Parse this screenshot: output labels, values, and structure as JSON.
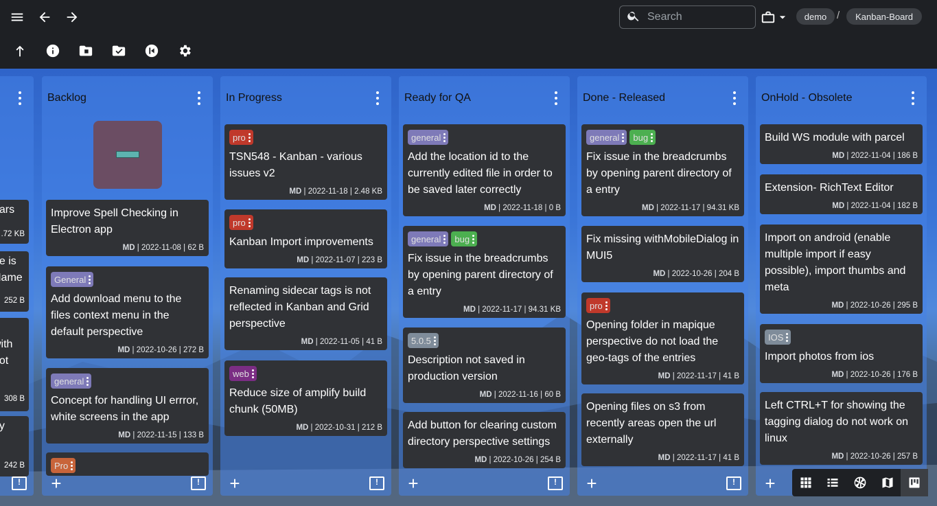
{
  "search": {
    "placeholder": "Search"
  },
  "breadcrumb": {
    "location": "demo",
    "folder": "Kanban-Board"
  },
  "columns": [
    {
      "title": "Backlog"
    },
    {
      "title": "In Progress"
    },
    {
      "title": "Ready for QA"
    },
    {
      "title": "Done - Released"
    },
    {
      "title": "OnHold - Obsolete"
    }
  ],
  "partial_col": {
    "texts": [
      "ears",
      ".72 KB",
      "ge is",
      "Name",
      "252 B",
      "with",
      "not",
      "308 B",
      "by",
      "n",
      "242 B"
    ]
  },
  "backlog": [
    {
      "title": "Improve Spell Checking in Electron app",
      "date": "2022-11-08",
      "size": "62 B",
      "author": "MD"
    },
    {
      "tag": "General",
      "title": "Add download menu to the files context menu in the default perspective",
      "date": "2022-10-26",
      "size": "272 B",
      "author": "MD"
    },
    {
      "tag": "general",
      "title": "Concept for handling UI errror, white screens in the app",
      "date": "2022-11-15",
      "size": "133 B",
      "author": "MD"
    },
    {
      "tag": "Pro"
    }
  ],
  "inprogress": [
    {
      "tag": "pro",
      "title": "TSN548 - Kanban - various issues v2",
      "date": "2022-11-18",
      "size": "2.48 KB",
      "author": "MD"
    },
    {
      "tag": "pro",
      "title": "Kanban Import improvements",
      "date": "2022-11-07",
      "size": "223 B",
      "author": "MD"
    },
    {
      "title": "Renaming sidecar tags is not reflected in Kanban and Grid perspective",
      "date": "2022-11-05",
      "size": "41 B",
      "author": "MD"
    },
    {
      "tag": "web",
      "title": "Reduce size of amplify build chunk (50MB)",
      "date": "2022-10-31",
      "size": "212 B",
      "author": "MD"
    }
  ],
  "readyqa": [
    {
      "tag": "general",
      "title": "Add the location id to the currently edited file in order to be saved later correctly",
      "date": "2022-11-18",
      "size": "0 B",
      "author": "MD"
    },
    {
      "tag": "general",
      "tag2": "bug",
      "title": "Fix issue in the breadcrumbs by opening parent directory of a entry",
      "date": "2022-11-17",
      "size": "94.31 KB",
      "author": "MD"
    },
    {
      "tag": "5.0.5",
      "title": "Description not saved in production version",
      "date": "2022-11-16",
      "size": "60 B",
      "author": "MD"
    },
    {
      "title": "Add button for clearing custom directory perspective settings",
      "date": "2022-10-26",
      "size": "254 B",
      "author": "MD"
    }
  ],
  "done": [
    {
      "tag": "general",
      "tag2": "bug",
      "title": "Fix issue in the breadcrumbs by opening parent directory of a entry",
      "date": "2022-11-17",
      "size": "94.31 KB",
      "author": "MD"
    },
    {
      "title": "Fix missing withMobileDialog in MUI5",
      "date": "2022-10-26",
      "size": "204 B",
      "author": "MD"
    },
    {
      "tag": "pro",
      "title": "Opening folder in mapique perspective do not load the geo-tags of the entries",
      "date": "2022-11-17",
      "size": "41 B",
      "author": "MD"
    },
    {
      "title": "Opening files on s3 from recently areas open the url externally",
      "date": "2022-11-17",
      "size": "41 B",
      "author": "MD"
    }
  ],
  "onhold": [
    {
      "title": "Build WS module with parcel",
      "date": "2022-11-04",
      "size": "186 B",
      "author": "MD"
    },
    {
      "title": "Extension- RichText Editor",
      "date": "2022-11-04",
      "size": "182 B",
      "author": "MD"
    },
    {
      "title": "Import on android (enable multiple import if easy possible), import thumbs and meta",
      "date": "2022-10-26",
      "size": "295 B",
      "author": "MD"
    },
    {
      "tag": "IOS",
      "title": "Import photos from ios",
      "date": "2022-10-26",
      "size": "176 B",
      "author": "MD"
    },
    {
      "title": "Left CTRL+T for showing the tagging dialog do not work on linux",
      "date": "2022-10-26",
      "size": "257 B",
      "author": "MD"
    }
  ],
  "colors": {
    "tag_general": "#7e7ab8",
    "tag_bug": "#4caf50",
    "tag_pro": "#c0392b",
    "tag_Pro": "#c8643a",
    "tag_web": "#7b2d84",
    "tag_505": "#7f8c9a",
    "tag_ios": "#7f8c9a"
  }
}
